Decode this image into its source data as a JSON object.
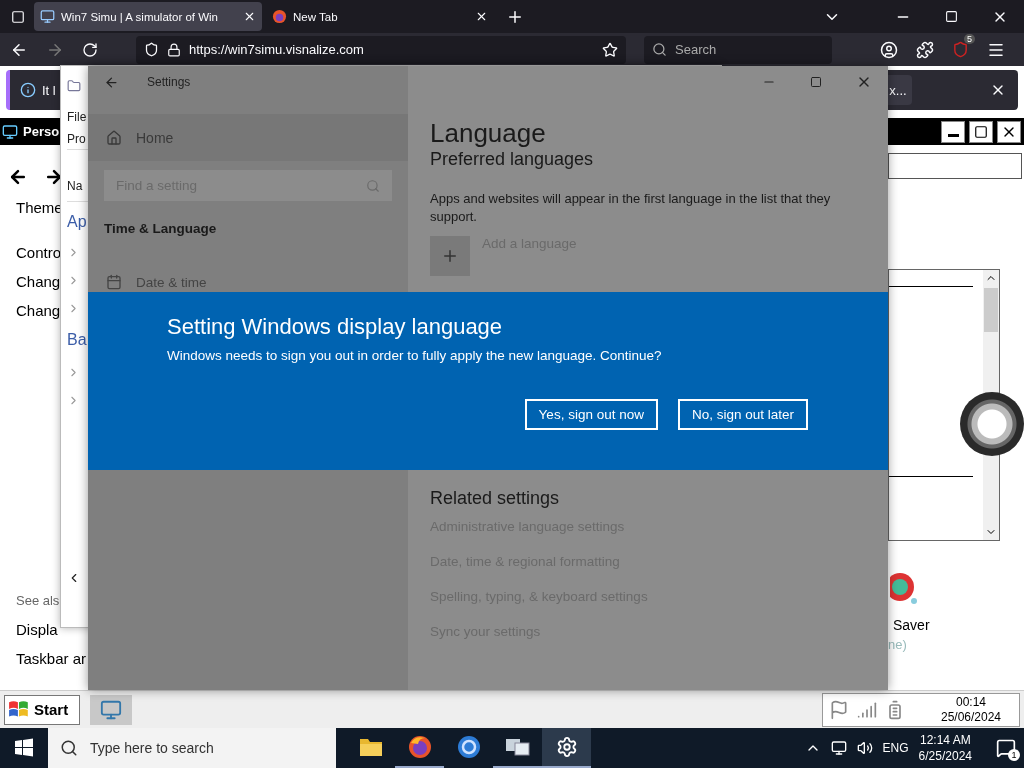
{
  "browser": {
    "tabs": [
      {
        "title": "Win7 Simu | A simulator of Win",
        "selected": true
      },
      {
        "title": "New Tab",
        "selected": false
      }
    ],
    "url": "https://win7simu.visnalize.com",
    "search": {
      "placeholder": "Search"
    },
    "extension_badge": "5",
    "notification": {
      "text": "It l",
      "action": "x..."
    }
  },
  "personalization": {
    "title": "Perso",
    "links": [
      "Theme",
      "Contro",
      "Chang",
      "Chang"
    ],
    "see_also": "See als",
    "see_also_links": [
      "Displa",
      "Taskbar ar"
    ],
    "screen_saver": {
      "label": "Saver",
      "value": "ne)"
    }
  },
  "explorer": {
    "menu": "File",
    "toolbar": "Pro",
    "column": "Na",
    "rows": [
      {
        "kind": "group",
        "text": "Ap"
      },
      {
        "kind": "item"
      },
      {
        "kind": "item"
      },
      {
        "kind": "item"
      },
      {
        "kind": "group",
        "text": "Ba"
      },
      {
        "kind": "item"
      },
      {
        "kind": "item"
      }
    ]
  },
  "settings": {
    "title": "Settings",
    "home": "Home",
    "search_placeholder": "Find a setting",
    "section": "Time & Language",
    "nav_items": [
      "Date & time"
    ],
    "page_title": "Language",
    "heading": "Preferred languages",
    "description": "Apps and websites will appear in the first language in the list that they support.",
    "add_language": "Add a language",
    "related_heading": "Related settings",
    "related_links": [
      "Administrative language settings",
      "Date, time & regional formatting",
      "Spelling, typing, & keyboard settings",
      "Sync your settings"
    ]
  },
  "dialog": {
    "title": "Setting Windows display language",
    "message": "Windows needs to sign you out in order to fully apply the new language. Continue?",
    "buttons": [
      "Yes, sign out now",
      "No, sign out later"
    ]
  },
  "win7_taskbar": {
    "start": "Start",
    "time": "00:14",
    "date": "25/06/2024"
  },
  "taskbar": {
    "search_placeholder": "Type here to search",
    "apps": [
      {
        "kind": "folder",
        "running": false,
        "selected": false
      },
      {
        "kind": "fox",
        "running": true,
        "selected": false
      },
      {
        "kind": "ring",
        "running": false,
        "selected": false
      },
      {
        "kind": "screens",
        "running": true,
        "selected": false
      },
      {
        "kind": "gear",
        "running": true,
        "selected": true
      }
    ],
    "language": "ENG",
    "time": "12:14 AM",
    "date": "6/25/2024",
    "notification_count": "1"
  }
}
